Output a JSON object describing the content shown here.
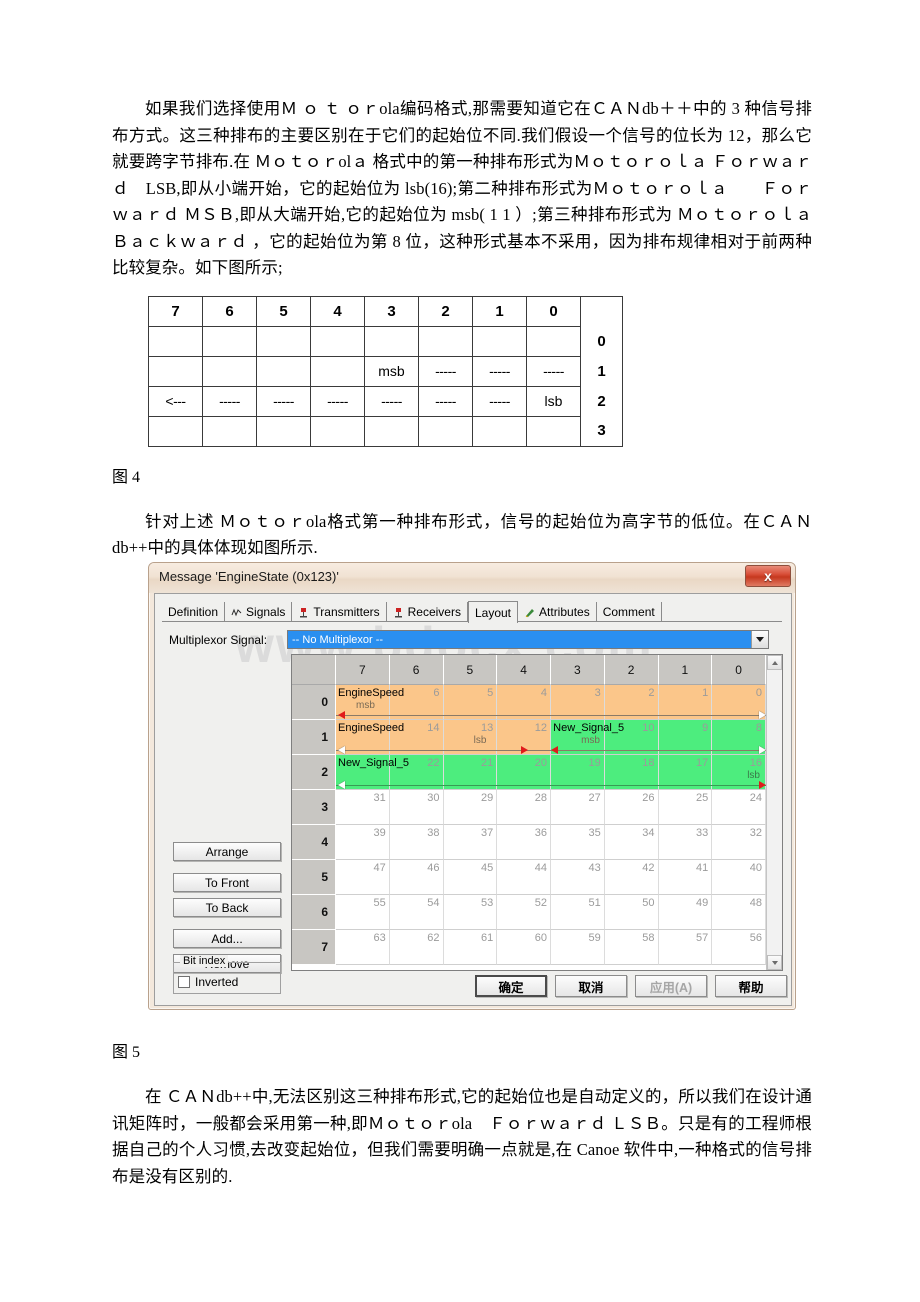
{
  "document": {
    "paragraph1": "如果我们选择使用Ｍ ｏ ｔ ｏｒola编码格式,那需要知道它在ＣＡＮdb＋＋中的 3 种信号排布方式。这三种排布的主要区别在于它们的起始位不同.我们假设一个信号的位长为 12，那么它就要跨字节排布.在 Ｍｏｔｏｒolａ 格式中的第一种排布形式为Ｍｏｔｏｒｏｌａ Ｆｏｒｗａｒｄ　LSB,即从小端开始，它的起始位为 lsb(16);第二种排布形式为Ｍｏｔｏｒｏｌａ　　Ｆｏｒｗａｒｄ ＭＳＢ,即从大端开始,它的起始位为 msb( 1 1 ）;第三种排布形式为 Ｍｏｔｏｒｏｌａ　　Ｂａｃｋｗａｒｄ ，它的起始位为第 8 位，这种形式基本不采用，因为排布规律相对于前两种比较复杂。如下图所示;",
    "figure4_caption": "图 4",
    "paragraph2": "针对上述 Ｍｏｔｏｒola格式第一种排布形式，信号的起始位为高字节的低位。在ＣＡＮdb++中的具体体现如图所示.",
    "figure5_caption": "图 5",
    "paragraph3": "在 ＣＡＮdb++中,无法区别这三种排布形式,它的起始位也是自动定义的，所以我们在设计通讯矩阵时，一般都会采用第一种,即Ｍｏｔｏｒola　Ｆｏｒｗａｒｄ ＬＳＢ。只是有的工程师根据自己的个人习惯,去改变起始位，但我们需要明确一点就是,在 Canoe 软件中,一种格式的信号排布是没有区别的."
  },
  "bit_table": {
    "column_headers": [
      "7",
      "6",
      "5",
      "4",
      "3",
      "2",
      "1",
      "0"
    ],
    "row_labels": [
      "0",
      "1",
      "2",
      "3"
    ],
    "rows": [
      [
        "",
        "",
        "",
        "",
        "",
        "",
        "",
        ""
      ],
      [
        "",
        "",
        "",
        "",
        "msb",
        "-----",
        "-----",
        "-----"
      ],
      [
        "<---",
        "-----",
        "-----",
        "-----",
        "-----",
        "-----",
        "-----",
        "lsb"
      ],
      [
        "",
        "",
        "",
        "",
        "",
        "",
        "",
        ""
      ]
    ]
  },
  "dialog": {
    "title": "Message 'EngineState (0x123)'",
    "close_label": "x",
    "watermark": "www.bdocx.com",
    "tabs": [
      {
        "label": "Definition",
        "icon": "",
        "active": false
      },
      {
        "label": "Signals",
        "icon": "signal-icon",
        "active": false
      },
      {
        "label": "Transmitters",
        "icon": "transmitter-icon",
        "active": false
      },
      {
        "label": "Receivers",
        "icon": "receiver-icon",
        "active": false
      },
      {
        "label": "Layout",
        "icon": "",
        "active": true
      },
      {
        "label": "Attributes",
        "icon": "attributes-icon",
        "active": false
      },
      {
        "label": "Comment",
        "icon": "",
        "active": false
      }
    ],
    "multiplexor": {
      "label": "Multiplexor Signal:",
      "value": "-- No Multiplexor --"
    },
    "grid": {
      "column_headers": [
        "7",
        "6",
        "5",
        "4",
        "3",
        "2",
        "1",
        "0"
      ],
      "row_labels": [
        "0",
        "1",
        "2",
        "3",
        "4",
        "5",
        "6",
        "7"
      ],
      "rows": [
        {
          "label": "0",
          "bits": [
            "7",
            "6",
            "5",
            "4",
            "3",
            "2",
            "1",
            "0"
          ],
          "signals": [
            {
              "name": "EngineSpeed",
              "color": "orange",
              "start": 0,
              "span": 8,
              "tag": "msb",
              "tag_col": 0,
              "left_arrow": "red-left",
              "right_arrow": "white-right"
            }
          ]
        },
        {
          "label": "1",
          "bits": [
            "15",
            "14",
            "13",
            "12",
            "11",
            "10",
            "9",
            "8"
          ],
          "signals": [
            {
              "name": "EngineSpeed",
              "color": "orange",
              "start": 0,
              "span": 4,
              "tag": "lsb",
              "tag_col": 2,
              "left_arrow": "white-left",
              "right_arrow": "red-right"
            },
            {
              "name": "New_Signal_5",
              "color": "green",
              "start": 4,
              "span": 4,
              "tag": "msb",
              "tag_col": 0,
              "left_arrow": "red-left",
              "right_arrow": "white-right"
            }
          ]
        },
        {
          "label": "2",
          "bits": [
            "23",
            "22",
            "21",
            "20",
            "19",
            "18",
            "17",
            "16"
          ],
          "signals": [
            {
              "name": "New_Signal_5",
              "color": "green",
              "start": 0,
              "span": 8,
              "tag": "lsb",
              "tag_col": 7,
              "left_arrow": "white-left",
              "right_arrow": "red-right"
            }
          ]
        },
        {
          "label": "3",
          "bits": [
            "31",
            "30",
            "29",
            "28",
            "27",
            "26",
            "25",
            "24"
          ],
          "signals": []
        },
        {
          "label": "4",
          "bits": [
            "39",
            "38",
            "37",
            "36",
            "35",
            "34",
            "33",
            "32"
          ],
          "signals": []
        },
        {
          "label": "5",
          "bits": [
            "47",
            "46",
            "45",
            "44",
            "43",
            "42",
            "41",
            "40"
          ],
          "signals": []
        },
        {
          "label": "6",
          "bits": [
            "55",
            "54",
            "53",
            "52",
            "51",
            "50",
            "49",
            "48"
          ],
          "signals": []
        },
        {
          "label": "7",
          "bits": [
            "63",
            "62",
            "61",
            "60",
            "59",
            "58",
            "57",
            "56"
          ],
          "signals": []
        }
      ]
    },
    "side_buttons": [
      {
        "label": "Arrange"
      },
      {
        "label": "To Front"
      },
      {
        "label": "To Back"
      },
      {
        "label": "Add..."
      },
      {
        "label": "Remove"
      }
    ],
    "bit_index_group": {
      "title": "Bit index",
      "checkbox_label": "Inverted",
      "checked": false
    },
    "dialog_buttons": [
      {
        "label": "确定",
        "default": true,
        "disabled": false
      },
      {
        "label": "取消",
        "default": false,
        "disabled": false
      },
      {
        "label": "应用(A)",
        "default": false,
        "disabled": true
      },
      {
        "label": "帮助",
        "default": false,
        "disabled": false
      }
    ]
  },
  "colors": {
    "signal_orange": "#fbc68a",
    "signal_green": "#4ded7e",
    "selection_blue": "#2a8ff0",
    "titlebar": "#f1e2d3",
    "close_red": "#d9503a"
  }
}
